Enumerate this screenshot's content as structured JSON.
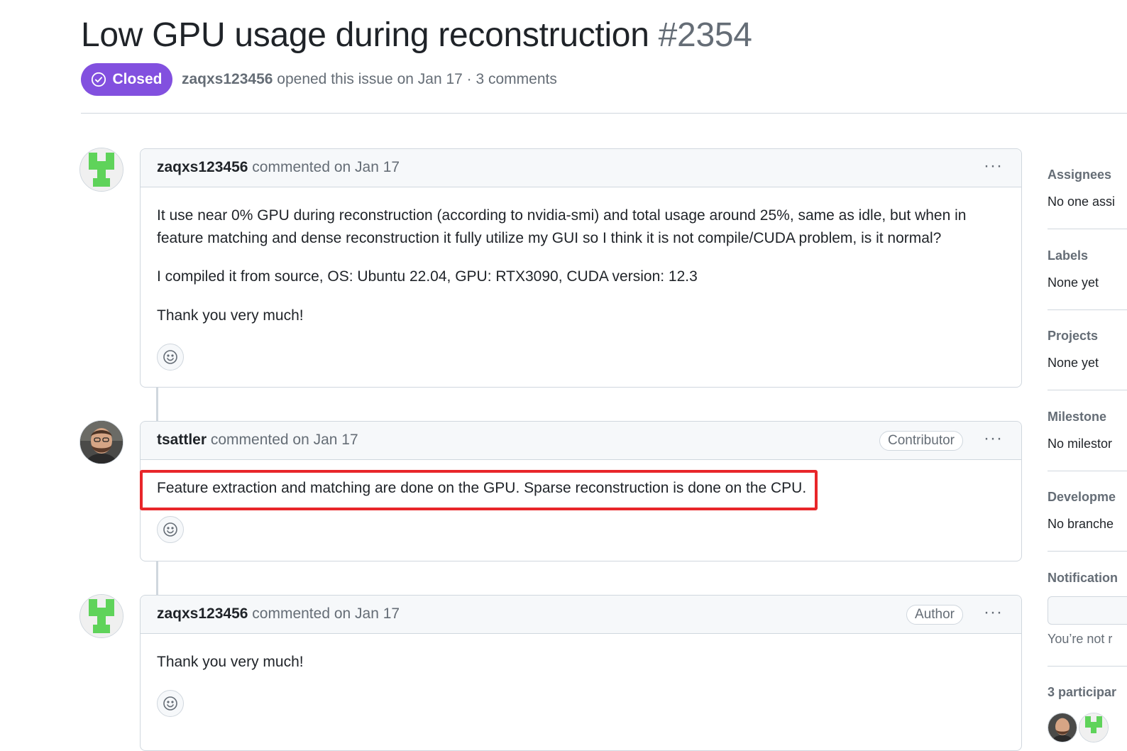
{
  "issue": {
    "title": "Low GPU usage during reconstruction",
    "number": "#2354",
    "state": "Closed",
    "author": "zaqxs123456",
    "meta_rest": " opened this issue on Jan 17 · 3 comments",
    "state_color": "#8250df"
  },
  "comments": [
    {
      "author": "zaqxs123456",
      "meta": " commented on Jan 17",
      "role": "",
      "paragraphs": [
        "It use near 0% GPU during reconstruction (according to nvidia-smi) and total usage around 25%, same as idle, but when in feature matching and dense reconstruction it fully utilize my GUI so I think it is not compile/CUDA problem, is it normal?",
        "I compiled it from source, OS: Ubuntu 22.04, GPU: RTX3090, CUDA version: 12.3",
        "Thank you very much!"
      ]
    },
    {
      "author": "tsattler",
      "meta": " commented on Jan 17",
      "role": "Contributor",
      "paragraphs": [
        "Feature extraction and matching are done on the GPU. Sparse reconstruction is done on the CPU."
      ]
    },
    {
      "author": "zaqxs123456",
      "meta": " commented on Jan 17",
      "role": "Author",
      "paragraphs": [
        "Thank you very much!"
      ]
    }
  ],
  "kebab": "···",
  "sidebar": {
    "assignees": {
      "heading": "Assignees",
      "value": "No one assi"
    },
    "labels": {
      "heading": "Labels",
      "value": "None yet"
    },
    "projects": {
      "heading": "Projects",
      "value": "None yet"
    },
    "milestone": {
      "heading": "Milestone",
      "value": "No milestor"
    },
    "development": {
      "heading": "Developme",
      "value": "No branche"
    },
    "notifications": {
      "heading": "Notification",
      "note": "You’re not r"
    },
    "participants": {
      "heading": "3 participar"
    }
  },
  "highlight_color": "#e8262a"
}
